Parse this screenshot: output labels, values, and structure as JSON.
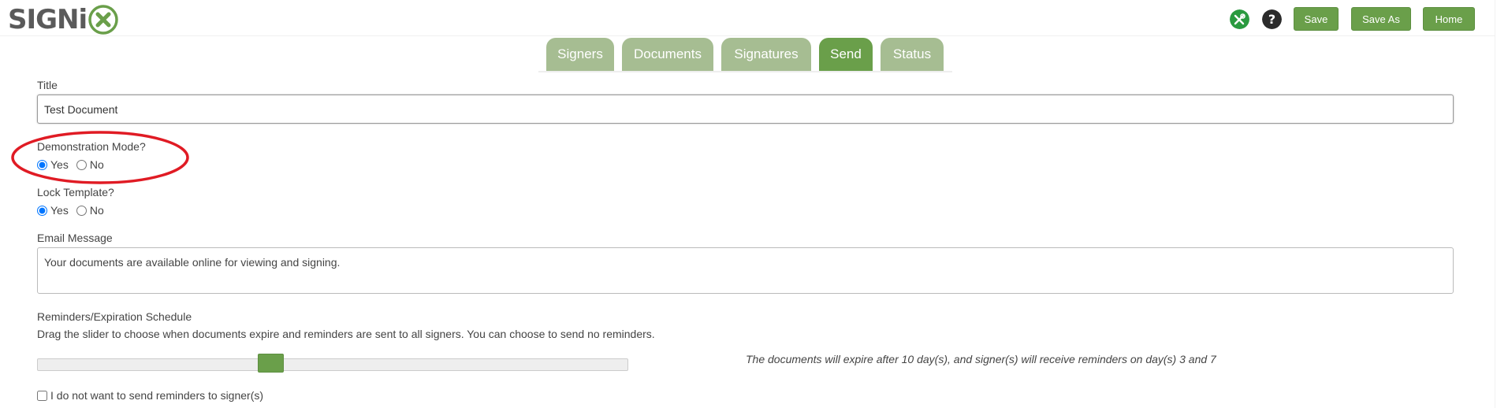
{
  "header": {
    "logo_text": "SIGNi",
    "buttons": {
      "save": "Save",
      "save_as": "Save As",
      "home": "Home"
    },
    "icons": {
      "tools": "tools-icon",
      "help": "help-icon"
    }
  },
  "tabs": [
    {
      "label": "Signers",
      "active": false
    },
    {
      "label": "Documents",
      "active": false
    },
    {
      "label": "Signatures",
      "active": false
    },
    {
      "label": "Send",
      "active": true
    },
    {
      "label": "Status",
      "active": false
    }
  ],
  "form": {
    "title_label": "Title",
    "title_value": "Test Document",
    "demo_label": "Demonstration Mode?",
    "demo_yes": "Yes",
    "demo_no": "No",
    "demo_selected": "Yes",
    "lock_label": "Lock Template?",
    "lock_yes": "Yes",
    "lock_no": "No",
    "lock_selected": "Yes",
    "email_label": "Email Message",
    "email_value": "Your documents are available online for viewing and signing.",
    "reminders_label": "Reminders/Expiration Schedule",
    "reminders_desc": "Drag the slider to choose when documents expire and reminders are sent to all signers. You can choose to send no reminders.",
    "expiry_text": "The documents will expire after 10 day(s), and signer(s) will receive reminders on day(s) 3 and 7",
    "slider_fraction": 0.39,
    "no_reminders_label": "I do not want to send reminders to signer(s)",
    "no_reminders_checked": false
  },
  "colors": {
    "brand_green": "#6a9f4a",
    "tab_inactive": "#a6bd92",
    "highlight_red": "#e01b24",
    "logo_gray": "#5a5a5a"
  }
}
